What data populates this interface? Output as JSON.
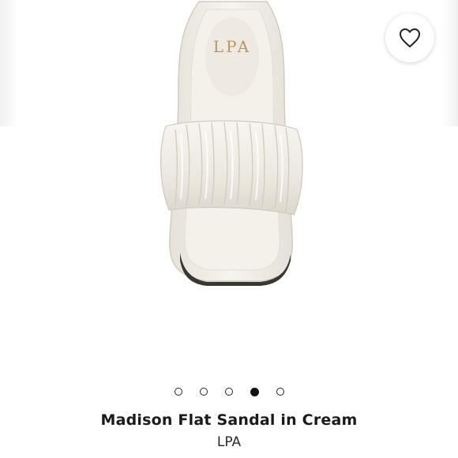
{
  "product": {
    "title": "Madison Flat Sandal in Cream",
    "brand": "LPA",
    "insole_logo_text": "LPA",
    "color_name": "Cream"
  },
  "wishlist": {
    "icon": "heart-icon"
  },
  "carousel": {
    "total_slides": 5,
    "active_slide": 4
  },
  "colors": {
    "sandal": "#f2efe9",
    "insole_logo": "#b59a5c",
    "dot_active": "#111111"
  }
}
